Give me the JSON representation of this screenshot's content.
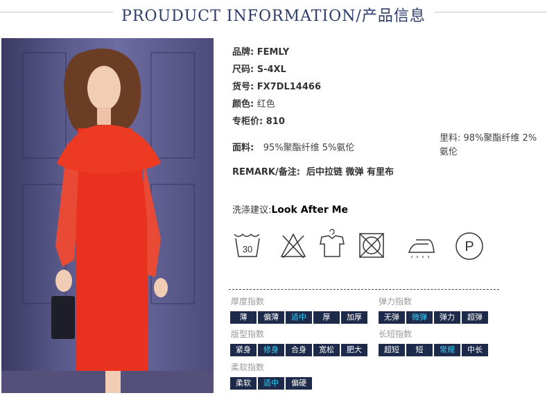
{
  "header": {
    "title": "PROUDUCT INFORMATION/产品信息"
  },
  "info": {
    "brand_label": "品牌:",
    "brand": "FEMLY",
    "size_label": "尺码:",
    "size": "S-4XL",
    "sku_label": "货号:",
    "sku": "FX7DL14466",
    "color_label": "颜色:",
    "color": "红色",
    "price_label": "专柜价:",
    "price": "810",
    "fabric_label": "面料:",
    "fabric": "95%聚酯纤维 5%氨伦",
    "lining_label": "里料:",
    "lining_line1": "98%聚酯纤维 2%",
    "lining_line2": "氨伦",
    "remark_label": "REMARK/备注:",
    "remark": "后中拉链 微弹 有里布",
    "wash_label": "洗涤建议:",
    "wash": "Look After Me"
  },
  "care_icons": [
    {
      "name": "wash-30-icon",
      "text": "30"
    },
    {
      "name": "no-bleach-icon"
    },
    {
      "name": "hang-dry-icon"
    },
    {
      "name": "no-tumble-dry-icon"
    },
    {
      "name": "iron-icon"
    },
    {
      "name": "dry-clean-p-icon",
      "text": "P"
    }
  ],
  "indices": {
    "thickness": {
      "title": "厚度指数",
      "options": [
        "薄",
        "偏薄",
        "适中",
        "厚",
        "加厚"
      ],
      "selected": "适中"
    },
    "elasticity": {
      "title": "弹力指数",
      "options": [
        "无弹",
        "微弹",
        "弹力",
        "超弹"
      ],
      "selected": "微弹"
    },
    "fit": {
      "title": "版型指数",
      "options": [
        "紧身",
        "修身",
        "合身",
        "宽松",
        "肥大"
      ],
      "selected": "修身"
    },
    "length": {
      "title": "长短指数",
      "options": [
        "超短",
        "短",
        "常规",
        "中长"
      ],
      "selected": "常规"
    },
    "softness": {
      "title": "柔软指数",
      "options": [
        "柔软",
        "适中",
        "偏硬"
      ],
      "selected": "适中"
    }
  },
  "colors": {
    "title": "#2d3b6a",
    "chip_bg": "#1e2a4a",
    "chip_selected_text": "#35d6ff",
    "dress": "#e8321f"
  }
}
